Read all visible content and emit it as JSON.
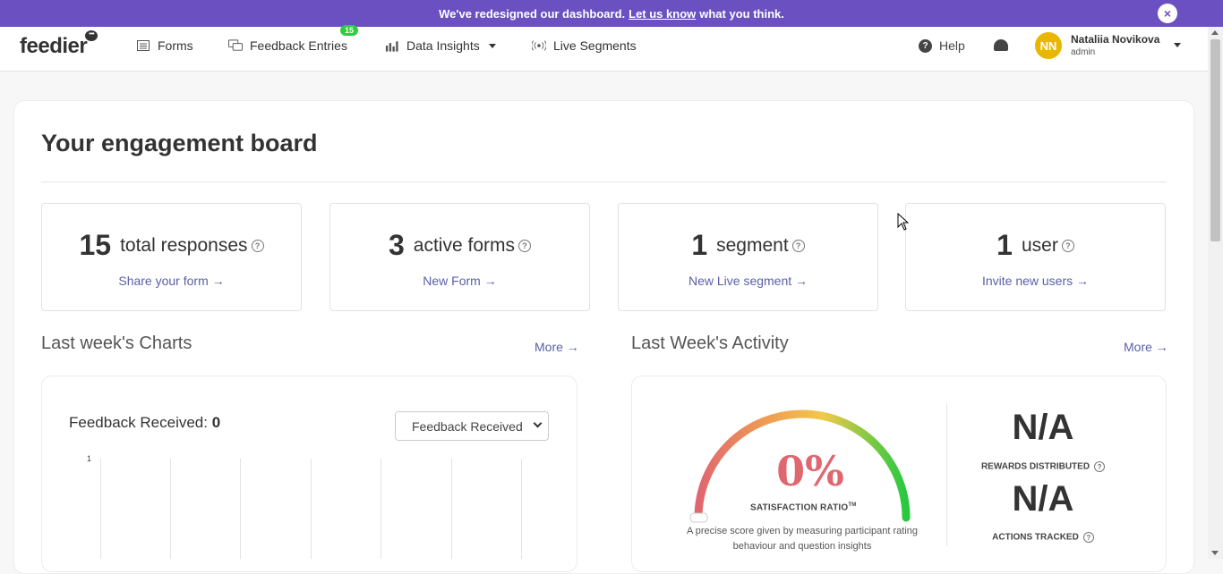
{
  "banner": {
    "text_before": "We've redesigned our dashboard.",
    "link": "Let us know",
    "text_after": "what you think.",
    "close": "×"
  },
  "nav": {
    "logo": "feedier",
    "logo_bubble": "•••",
    "items": [
      {
        "label": "Forms",
        "icon": "list-icon"
      },
      {
        "label": "Feedback Entries",
        "icon": "chat-icon",
        "badge": "15"
      },
      {
        "label": "Data Insights",
        "icon": "bar-chart-icon"
      },
      {
        "label": "Live Segments",
        "icon": "broadcast-icon"
      }
    ],
    "help": "Help",
    "user": {
      "initials": "NN",
      "name": "Nataliia Novikova",
      "role": "admin"
    }
  },
  "board": {
    "title": "Your engagement board",
    "stats": [
      {
        "value": "15",
        "label": "total responses",
        "link": "Share your form"
      },
      {
        "value": "3",
        "label": "active forms",
        "link": "New Form"
      },
      {
        "value": "1",
        "label": "segment",
        "link": "New Live segment"
      },
      {
        "value": "1",
        "label": "user",
        "link": "Invite new users"
      }
    ],
    "charts": {
      "title": "Last week's Charts",
      "more": "More",
      "feedback_label": "Feedback Received:",
      "feedback_value": "0",
      "select_value": "Feedback Received",
      "y_tick": "1"
    },
    "activity": {
      "title": "Last Week's Activity",
      "more": "More",
      "percent": "0%",
      "ratio_label": "SATISFACTION RATIO",
      "tm": "TM",
      "description": "A precise score given by measuring participant rating behaviour and question insights",
      "rewards_value": "N/A",
      "rewards_label": "REWARDS DISTRIBUTED",
      "actions_value": "N/A",
      "actions_label": "ACTIONS TRACKED",
      "gauge_level": 0
    }
  },
  "colors": {
    "accent": "#6a50c0",
    "link": "#5b5fa8",
    "badge": "#2ecc40",
    "avatar": "#e9b700",
    "percent": "#e06670"
  }
}
